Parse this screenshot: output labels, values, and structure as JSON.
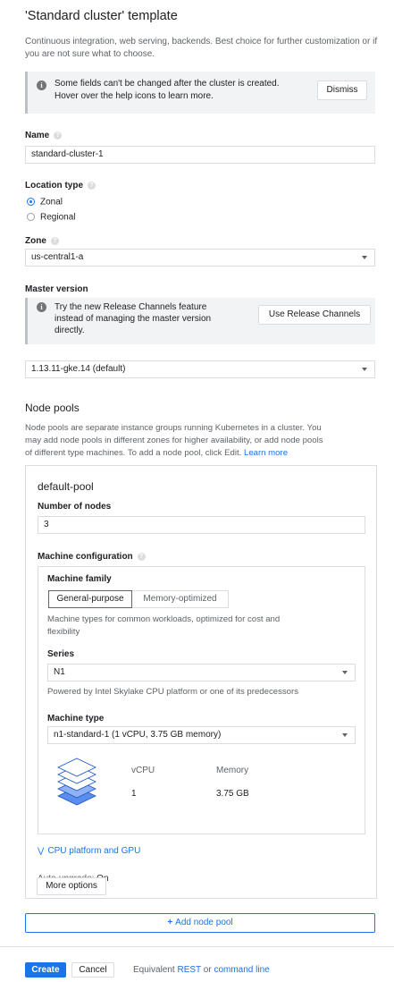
{
  "page": {
    "title": "'Standard cluster' template",
    "description": "Continuous integration, web serving, backends. Best choice for further customization or if you are not sure what to choose."
  },
  "notice": {
    "text_line1": "Some fields can't be changed after the cluster is created.",
    "text_line2": "Hover over the help icons to learn more.",
    "dismiss_label": "Dismiss"
  },
  "name_field": {
    "label": "Name",
    "value": "standard-cluster-1"
  },
  "location_type": {
    "label": "Location type",
    "options": [
      "Zonal",
      "Regional"
    ],
    "selected": "Zonal"
  },
  "zone": {
    "label": "Zone",
    "value": "us-central1-a"
  },
  "master_version": {
    "label": "Master version",
    "notice_line1": "Try the new Release Channels feature",
    "notice_line2": "instead of managing the master version",
    "notice_line3": "directly.",
    "button_label": "Use Release Channels",
    "value": "1.13.11-gke.14 (default)"
  },
  "node_pools": {
    "heading": "Node pools",
    "description_line1": "Node pools are separate instance groups running Kubernetes in a cluster. You",
    "description_line2": "may add node pools in different zones for higher availability, or add node pools",
    "description_line3": "of different type machines. To add a node pool, click Edit.",
    "learn_more": "Learn more"
  },
  "pool": {
    "name": "default-pool",
    "nodes_label": "Number of nodes",
    "nodes_value": "3",
    "machine_config_label": "Machine configuration",
    "family_label": "Machine family",
    "tabs": [
      "General-purpose",
      "Memory-optimized"
    ],
    "selected_tab": "General-purpose",
    "family_desc_line1": "Machine types for common workloads, optimized for cost and",
    "family_desc_line2": "flexibility",
    "series_label": "Series",
    "series_value": "N1",
    "series_desc": "Powered by Intel Skylake CPU platform or one of its predecessors",
    "machine_type_label": "Machine type",
    "machine_type_value": "n1-standard-1 (1 vCPU, 3.75 GB memory)",
    "vcpu_header": "vCPU",
    "memory_header": "Memory",
    "vcpu_value": "1",
    "memory_value": "3.75 GB",
    "cpu_gpu_link": "CPU platform and GPU",
    "autoupgrade_label": "Auto-upgrade: ",
    "autoupgrade_value": "On",
    "more_options": "More options"
  },
  "add_node_pool": "Add node pool",
  "footer": {
    "create": "Create",
    "cancel": "Cancel",
    "equivalent": "Equivalent",
    "rest": "REST",
    "or": "or",
    "command_line": "command line"
  },
  "icons": {
    "info": "info-icon",
    "help": "help-icon",
    "dropdown": "dropdown-arrow-icon",
    "stack": "machine-stack-icon",
    "expand": "chevron-double-down-icon",
    "add": "plus-icon"
  },
  "colors": {
    "accent": "#1a73e8",
    "border": "#dadce0",
    "muted": "#5f6368",
    "notice_bg": "#f1f3f4"
  }
}
